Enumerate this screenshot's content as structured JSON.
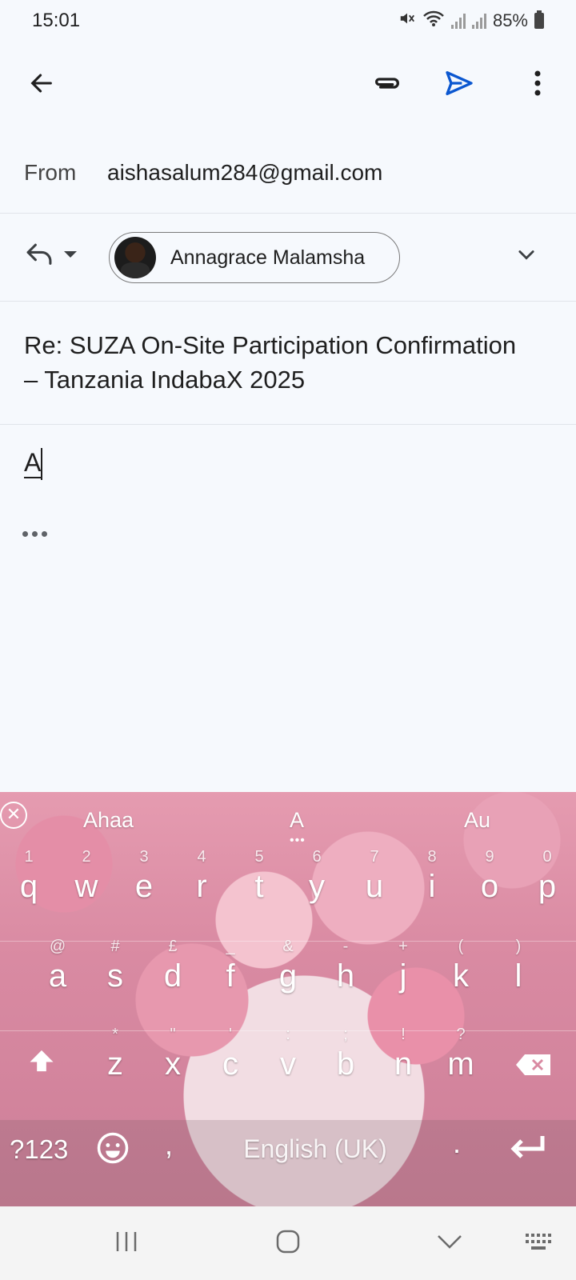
{
  "status_bar": {
    "time": "15:01",
    "battery": "85%",
    "icons": [
      "mute-icon",
      "wifi-icon",
      "signal-icon",
      "signal-icon",
      "battery-icon"
    ]
  },
  "toolbar": {
    "back_icon": "arrow-left-icon",
    "attach_icon": "paperclip-icon",
    "send_icon": "send-icon",
    "more_icon": "more-vert-icon",
    "send_color": "#0b57d0"
  },
  "from": {
    "label": "From",
    "value": "aishasalum284@gmail.com"
  },
  "to": {
    "reply_icon": "reply-icon",
    "recipient_name": "Annagrace Malamsha",
    "expand_icon": "chevron-down-icon"
  },
  "subject": "Re: SUZA On-Site Participation Confirmation – Tanzania IndabaX 2025",
  "body": {
    "text": "A"
  },
  "keyboard": {
    "suggestions": [
      "Ahaa",
      "A",
      "Au"
    ],
    "row1": [
      {
        "key": "q",
        "hint": "1"
      },
      {
        "key": "w",
        "hint": "2"
      },
      {
        "key": "e",
        "hint": "3"
      },
      {
        "key": "r",
        "hint": "4"
      },
      {
        "key": "t",
        "hint": "5"
      },
      {
        "key": "y",
        "hint": "6"
      },
      {
        "key": "u",
        "hint": "7"
      },
      {
        "key": "i",
        "hint": "8"
      },
      {
        "key": "o",
        "hint": "9"
      },
      {
        "key": "p",
        "hint": "0"
      }
    ],
    "row2": [
      {
        "key": "a",
        "hint": "@"
      },
      {
        "key": "s",
        "hint": "#"
      },
      {
        "key": "d",
        "hint": "£"
      },
      {
        "key": "f",
        "hint": "_"
      },
      {
        "key": "g",
        "hint": "&"
      },
      {
        "key": "h",
        "hint": "-"
      },
      {
        "key": "j",
        "hint": "+"
      },
      {
        "key": "k",
        "hint": "("
      },
      {
        "key": "l",
        "hint": ")"
      }
    ],
    "row3": [
      {
        "key": "z",
        "hint": "*"
      },
      {
        "key": "x",
        "hint": "\""
      },
      {
        "key": "c",
        "hint": "'"
      },
      {
        "key": "v",
        "hint": ":"
      },
      {
        "key": "b",
        "hint": ";"
      },
      {
        "key": "n",
        "hint": "!"
      },
      {
        "key": "m",
        "hint": "?"
      }
    ],
    "symbols_key": "?123",
    "comma_key": ",",
    "space_label": "English (UK)",
    "period_key": "."
  }
}
